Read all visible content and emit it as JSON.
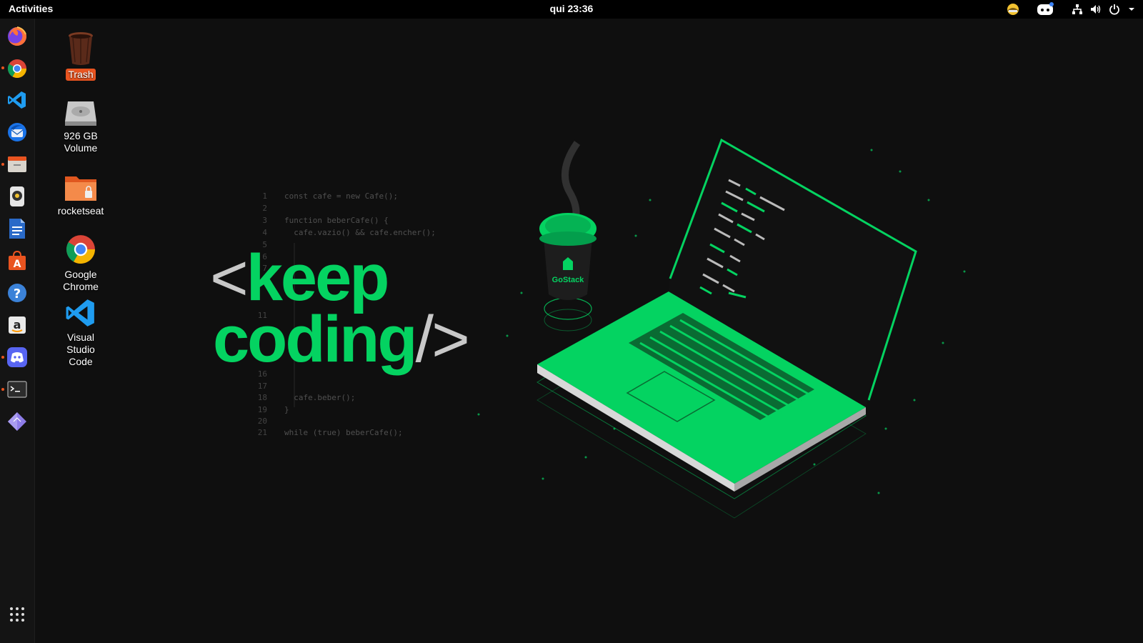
{
  "topbar": {
    "activities": "Activities",
    "clock": "qui 23:36"
  },
  "tray_icons": [
    "weather-icon",
    "discord-tray-icon",
    "network-icon",
    "volume-icon",
    "power-icon",
    "chevron-down-icon"
  ],
  "dock": {
    "items": [
      {
        "name": "firefox",
        "running": false
      },
      {
        "name": "chrome",
        "running": true
      },
      {
        "name": "vscode",
        "running": false
      },
      {
        "name": "thunderbird",
        "running": false
      },
      {
        "name": "files",
        "running": true
      },
      {
        "name": "rhythmbox",
        "running": false
      },
      {
        "name": "libreoffice-writer",
        "running": false
      },
      {
        "name": "software-center",
        "running": false
      },
      {
        "name": "help",
        "running": false
      },
      {
        "name": "amazon",
        "running": false
      },
      {
        "name": "discord",
        "running": true
      },
      {
        "name": "terminal",
        "running": true
      },
      {
        "name": "gem",
        "running": false
      }
    ],
    "show_apps": "show-applications-icon"
  },
  "desktop": {
    "trash": "Trash",
    "volume_line1": "926 GB",
    "volume_line2": "Volume",
    "rocketseat": "rocketseat",
    "chrome_line1": "Google",
    "chrome_line2": "Chrome",
    "vscode_line1": "Visual",
    "vscode_line2": "Studio",
    "vscode_line3": "Code"
  },
  "wallpaper": {
    "keep": "keep",
    "coding": "coding",
    "lt": "<",
    "close": "/>",
    "cup_brand": "GoStack",
    "code": [
      {
        "n": "1",
        "t": "const cafe = new Cafe();"
      },
      {
        "n": "2",
        "t": ""
      },
      {
        "n": "3",
        "t": "function beberCafe() {"
      },
      {
        "n": "4",
        "t": "  cafe.vazio() && cafe.encher();"
      },
      {
        "n": "5",
        "t": ""
      },
      {
        "n": "6",
        "t": ""
      },
      {
        "n": "7",
        "t": ""
      },
      {
        "n": "11",
        "t": ""
      },
      {
        "n": "16",
        "t": ""
      },
      {
        "n": "17",
        "t": ""
      },
      {
        "n": "18",
        "t": "  cafe.beber();"
      },
      {
        "n": "19",
        "t": "}"
      },
      {
        "n": "20",
        "t": ""
      },
      {
        "n": "21",
        "t": "while (true) beberCafe();"
      }
    ]
  }
}
